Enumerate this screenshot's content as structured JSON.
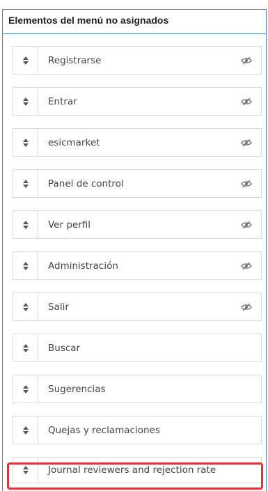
{
  "panel": {
    "title": "Elementos del menú no asignados",
    "border_color": "#4a86c5",
    "highlight_color": "#d9363e",
    "items": [
      {
        "label": "Registrarse",
        "hidden_icon": true
      },
      {
        "label": "Entrar",
        "hidden_icon": true
      },
      {
        "label": "esicmarket",
        "hidden_icon": true
      },
      {
        "label": "Panel de control",
        "hidden_icon": true
      },
      {
        "label": "Ver perfil",
        "hidden_icon": true
      },
      {
        "label": "Administración",
        "hidden_icon": true
      },
      {
        "label": "Salir",
        "hidden_icon": true
      },
      {
        "label": "Buscar",
        "hidden_icon": false
      },
      {
        "label": "Sugerencias",
        "hidden_icon": false
      },
      {
        "label": "Quejas y reclamaciones",
        "hidden_icon": false
      },
      {
        "label": "Journal reviewers and rejection rate",
        "hidden_icon": false,
        "highlighted": true
      }
    ],
    "icons": {
      "handle": "sort-arrows-icon",
      "visibility": "eye-slash-icon"
    }
  }
}
